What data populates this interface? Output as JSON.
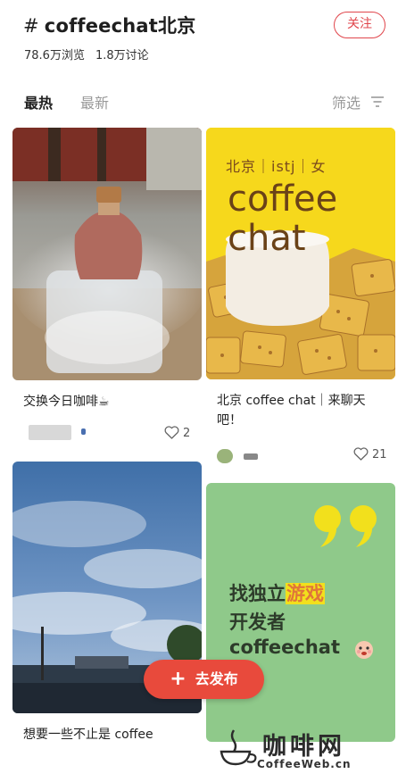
{
  "topic": {
    "hash": "#",
    "name": "coffeechat北京",
    "views": "78.6万浏览",
    "discussions": "1.8万讨论",
    "follow_label": "关注"
  },
  "tabs": {
    "hot": "最热",
    "new": "最新",
    "filter": "筛选"
  },
  "posts": [
    {
      "title": "交换今日咖啡☕",
      "likes": "2"
    },
    {
      "poster_tags": "北京｜istj｜女",
      "poster_line1": "coffee",
      "poster_line2": "chat",
      "title_line1": "北京 coffee chat｜来聊天",
      "title_line2": "吧！",
      "likes": "21"
    },
    {
      "title": "想要一些不止是 coffee"
    },
    {
      "poster_line1_prefix": "找独立",
      "poster_line1_highlight": "游戏",
      "poster_line2": "开发者",
      "poster_line3": "coffeechat"
    }
  ],
  "publish": {
    "label": "去发布"
  },
  "watermark": {
    "text": "咖啡网",
    "url": "CoffeeWeb.cn"
  },
  "colors": {
    "accent_red": "#e0464c",
    "publish_red": "#e84a3c",
    "poster_yellow": "#f6d81c",
    "poster_green": "#8fc98a",
    "poster_brown": "#7a4a1e"
  }
}
